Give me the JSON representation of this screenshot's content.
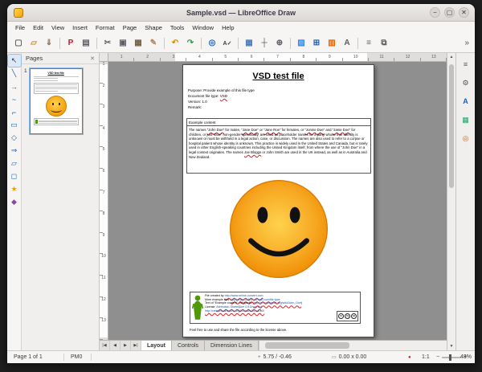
{
  "window": {
    "title": "Sample.vsd — LibreOffice Draw"
  },
  "window_controls": {
    "minimize": "−",
    "maximize": "▢",
    "close": "✕"
  },
  "menubar": [
    "File",
    "Edit",
    "View",
    "Insert",
    "Format",
    "Page",
    "Shape",
    "Tools",
    "Window",
    "Help"
  ],
  "toolbar": {
    "overflow": "»",
    "items": [
      {
        "n": "new-document-icon",
        "g": "▢",
        "s": "color:#5e5c64",
        "c": "tb-icon",
        "i": "true"
      },
      {
        "n": "open-folder-icon",
        "g": "▱",
        "s": "color:#c98f2c",
        "c": "tb-icon",
        "i": "true"
      },
      {
        "n": "save-icon",
        "g": "⇓",
        "s": "color:#8a6b4f",
        "c": "tb-icon",
        "i": "true"
      },
      {
        "n": "separator",
        "g": "",
        "s": "",
        "c": "tb-sep",
        "i": "false"
      },
      {
        "n": "export-pdf-icon",
        "g": "P",
        "s": "color:#c01c28",
        "c": "tb-icon",
        "i": "true"
      },
      {
        "n": "print-icon",
        "g": "▤",
        "s": "color:#5e5c64",
        "c": "tb-icon",
        "i": "true"
      },
      {
        "n": "separator",
        "g": "",
        "s": "",
        "c": "tb-sep",
        "i": "false"
      },
      {
        "n": "cut-icon",
        "g": "✂",
        "s": "color:#5e5c64",
        "c": "tb-icon",
        "i": "true"
      },
      {
        "n": "copy-icon",
        "g": "▣",
        "s": "color:#5e5c64",
        "c": "tb-icon",
        "i": "true"
      },
      {
        "n": "paste-icon",
        "g": "▦",
        "s": "color:#755f43",
        "c": "tb-icon",
        "i": "true"
      },
      {
        "n": "clone-formatting-icon",
        "g": "✎",
        "s": "color:#b5835a",
        "c": "tb-icon",
        "i": "true"
      },
      {
        "n": "separator",
        "g": "",
        "s": "",
        "c": "tb-sep",
        "i": "false"
      },
      {
        "n": "undo-icon",
        "g": "↶",
        "s": "color:#d98e00",
        "c": "tb-icon",
        "i": "true"
      },
      {
        "n": "redo-icon",
        "g": "↷",
        "s": "color:#2f9e44",
        "c": "tb-icon",
        "i": "true"
      },
      {
        "n": "separator",
        "g": "",
        "s": "",
        "c": "tb-sep",
        "i": "false"
      },
      {
        "n": "find-replace-icon",
        "g": "◎",
        "s": "color:#1a5fb4",
        "c": "tb-icon",
        "i": "true"
      },
      {
        "n": "spelling-icon",
        "g": "A✓",
        "s": "color:#3d3846;font-size:7px",
        "c": "tb-icon",
        "i": "true"
      },
      {
        "n": "separator",
        "g": "",
        "s": "",
        "c": "tb-sep",
        "i": "false"
      },
      {
        "n": "display-grid-icon",
        "g": "▦",
        "s": "color:#4a7dbd",
        "c": "tb-icon",
        "i": "true"
      },
      {
        "n": "helplines-icon",
        "g": "┼",
        "s": "color:#5e5c64",
        "c": "tb-icon",
        "i": "true"
      },
      {
        "n": "zoom-icon",
        "g": "⊕",
        "s": "color:#5e5c64",
        "c": "tb-icon",
        "i": "true"
      },
      {
        "n": "separator",
        "g": "",
        "s": "",
        "c": "tb-sep",
        "i": "false"
      },
      {
        "n": "insert-image-icon",
        "g": "▨",
        "s": "color:#3584e4",
        "c": "tb-icon",
        "i": "true"
      },
      {
        "n": "insert-table-icon",
        "g": "⊞",
        "s": "color:#1a5fb4",
        "c": "tb-icon",
        "i": "true"
      },
      {
        "n": "insert-chart-icon",
        "g": "▥",
        "s": "color:#e66100",
        "c": "tb-icon",
        "i": "true"
      },
      {
        "n": "insert-textbox-icon",
        "g": "A",
        "s": "color:#5e5c64",
        "c": "tb-icon",
        "i": "true"
      },
      {
        "n": "separator",
        "g": "",
        "s": "",
        "c": "tb-sep",
        "i": "false"
      },
      {
        "n": "align-objects-icon",
        "g": "≡",
        "s": "color:#5e5c64",
        "c": "tb-icon",
        "i": "true"
      },
      {
        "n": "arrange-icon",
        "g": "⧉",
        "s": "color:#5e5c64",
        "c": "tb-icon",
        "i": "true"
      }
    ]
  },
  "drawing_toolbar": {
    "items": [
      {
        "n": "select-icon",
        "g": "↖",
        "s": "color:#3d3846",
        "c": "db-icon sel",
        "i": "true"
      },
      {
        "n": "insert-line-icon",
        "g": "╲",
        "s": "color:#1a5fb4",
        "c": "db-icon",
        "i": "true"
      },
      {
        "n": "lines-arrows-icon",
        "g": "→",
        "s": "color:#1a5fb4",
        "c": "db-icon",
        "i": "true"
      },
      {
        "n": "curves-polygons-icon",
        "g": "~",
        "s": "color:#1a5fb4",
        "c": "db-icon",
        "i": "true"
      },
      {
        "n": "connectors-icon",
        "g": "⌐",
        "s": "color:#1a5fb4",
        "c": "db-icon",
        "i": "true"
      },
      {
        "n": "basic-shapes-icon",
        "g": "▭",
        "s": "color:#1a5fb4",
        "c": "db-icon",
        "i": "true"
      },
      {
        "n": "symbol-shapes-icon",
        "g": "◇",
        "s": "color:#1a5fb4",
        "c": "db-icon",
        "i": "true"
      },
      {
        "n": "block-arrows-icon",
        "g": "⇒",
        "s": "color:#1a5fb4",
        "c": "db-icon",
        "i": "true"
      },
      {
        "n": "flowchart-icon",
        "g": "▱",
        "s": "color:#1a5fb4",
        "c": "db-icon",
        "i": "true"
      },
      {
        "n": "callout-shapes-icon",
        "g": "◻",
        "s": "color:#1a5fb4",
        "c": "db-icon",
        "i": "true"
      },
      {
        "n": "stars-banners-icon",
        "g": "★",
        "s": "color:#e5a50a",
        "c": "db-icon",
        "i": "true"
      },
      {
        "n": "3d-objects-icon",
        "g": "◆",
        "s": "color:#9141ac",
        "c": "db-icon",
        "i": "true"
      }
    ]
  },
  "pages_panel": {
    "title": "Pages",
    "close": "✕",
    "page_number": "1"
  },
  "rulers": {
    "h": [
      "1",
      "2",
      "3",
      "4",
      "5",
      "6",
      "7",
      "8",
      "9",
      "10",
      "11",
      "12",
      "13"
    ],
    "v": [
      "1",
      "2",
      "3",
      "4",
      "5",
      "6",
      "7",
      "8",
      "9",
      "10",
      "11",
      "12",
      "13"
    ]
  },
  "document": {
    "title": "VSD test file",
    "meta": {
      "purpose": "Purpose: Provide example of this file type",
      "file_type_label": "Document file type: ",
      "file_type_value": "VSD",
      "version": "Version: 1.0",
      "remark": "Remark:"
    },
    "example_header": "Example content",
    "paragraph": [
      {
        "t": "The names ",
        "c": "w"
      },
      {
        "t": "\"John Doe\"",
        "c": "m"
      },
      {
        "t": " for males, ",
        "c": "w"
      },
      {
        "t": "\"Jane Doe\"",
        "c": "m"
      },
      {
        "t": " or ",
        "c": "w"
      },
      {
        "t": "\"Jane Roe\"",
        "c": "m"
      },
      {
        "t": " for females, or ",
        "c": "w"
      },
      {
        "t": "\"Jonnie Doe\"",
        "c": "m"
      },
      {
        "t": " and ",
        "c": "w"
      },
      {
        "t": "\"Janie Doe\"",
        "c": "m"
      },
      {
        "t": " for children, or just \"Doe\" non-gender-specifically, are used as placeholder names for a party whose true identity is unknown or must be withheld in a legal action, case, or discussion. The names are also used to refer to a corpse or hospital patient whose identity is unknown. This practice is widely used in the United States and Canada, but is rarely used in other English-speaking countries including the United Kingdom itself, from where the use of \"John Doe\" in a legal context originates. The names ",
        "c": "w"
      },
      {
        "t": "Joe Bloggs",
        "c": "m"
      },
      {
        "t": " or John Smith are used in the UK instead, as well as in Australia and New Zealand.",
        "c": "w"
      }
    ],
    "smiley": {
      "center": "#ffd24d",
      "mid": "#f7a721",
      "edge": "#ee8a00",
      "outline": "#d97b00",
      "eye": "#111111",
      "mouth": "#111111"
    },
    "footer": {
      "logo_color": "#4e9a06",
      "line1": [
        {
          "t": "File created by ",
          "c": "w"
        },
        {
          "t": "http://www.online-convert.com",
          "c": "k"
        }
      ],
      "line2": [
        {
          "t": "More example files: ",
          "c": "w"
        },
        {
          "t": "http://www.online-convert.com/file-type",
          "c": "k"
        }
      ],
      "line3": [
        {
          "t": "Text of \"Example content\": Wikipedia (",
          "c": "w"
        },
        {
          "t": "http://en.wikipedia.org/wiki/John_Doe",
          "c": "k"
        },
        {
          "t": ")",
          "c": "w"
        }
      ],
      "line4": [
        {
          "t": "License: ",
          "c": "w"
        },
        {
          "t": "Attribution-ShareAlike 3.0 Unported",
          "c": "k"
        }
      ],
      "line5": [
        {
          "t": "http://creativecommons.org/licenses/by-sa/3.0/",
          "c": "k"
        }
      ],
      "badges": [
        "cc",
        "by",
        "sa"
      ]
    },
    "closing": "Feel free to use and share the file according to the license above."
  },
  "layer_bar": {
    "nav": [
      {
        "n": "first-layer-button",
        "g": "|◀"
      },
      {
        "n": "previous-layer-button",
        "g": "◀"
      },
      {
        "n": "next-layer-button",
        "g": "▶"
      },
      {
        "n": "last-layer-button",
        "g": "▶|"
      }
    ],
    "tabs": [
      {
        "label": "Layout",
        "c": "tab active"
      },
      {
        "label": "Controls",
        "c": "tab"
      },
      {
        "label": "Dimension Lines",
        "c": "tab"
      }
    ]
  },
  "sidebar": {
    "icons": [
      {
        "n": "sidebar-settings-icon",
        "g": "≡",
        "s": "color:#555"
      },
      {
        "n": "properties-icon",
        "g": "⚙",
        "s": "color:#555"
      },
      {
        "n": "styles-icon",
        "g": "A",
        "s": "color:#1a5fb4;font-weight:bold"
      },
      {
        "n": "gallery-icon",
        "g": "▦",
        "s": "color:#26a269"
      },
      {
        "n": "navigator-icon",
        "g": "◎",
        "s": "color:#e66100"
      }
    ]
  },
  "scrollbar_glyphs": {
    "up": "▲",
    "down": "▼"
  },
  "statusbar": {
    "page": "Page 1 of 1",
    "style": "PM0",
    "position_icon": "+",
    "position": "5.75 / -0.46",
    "size_icon": "▭",
    "size": "0.00 x 0.00",
    "modified": "●",
    "scale": "1:1",
    "zoom_minus": "−",
    "zoom_plus": "+",
    "zoom": "48%"
  }
}
